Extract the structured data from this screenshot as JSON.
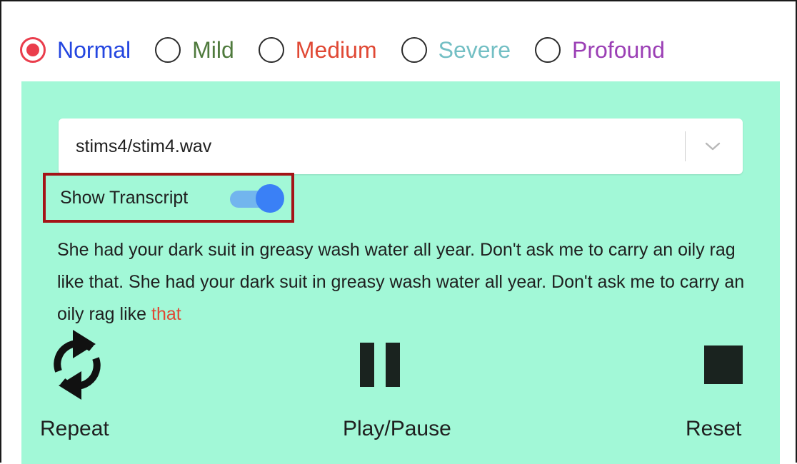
{
  "severity": {
    "options": [
      {
        "label": "Normal",
        "color": "#2446e0",
        "checked": true
      },
      {
        "label": "Mild",
        "color": "#4f7a3d",
        "checked": false
      },
      {
        "label": "Medium",
        "color": "#e04834",
        "checked": false
      },
      {
        "label": "Severe",
        "color": "#73bfc4",
        "checked": false
      },
      {
        "label": "Profound",
        "color": "#9b3fb5",
        "checked": false
      }
    ],
    "selected_color": "#ea3d4c"
  },
  "panel": {
    "background": "#a2f8d7"
  },
  "file_select": {
    "value": "stims4/stim4.wav",
    "icon": "chevron-down-icon"
  },
  "transcript_toggle": {
    "label": "Show Transcript",
    "on": true
  },
  "transcript": {
    "text": "She had your dark suit in greasy wash water all year. Don't ask me to carry an oily rag like that. She had your dark suit in greasy wash water all year. Don't ask me to carry an oily rag like ",
    "highlighted_word": "that",
    "highlight_color": "#e04834"
  },
  "controls": {
    "repeat": {
      "label": "Repeat",
      "icon": "repeat-icon"
    },
    "play_pause": {
      "label": "Play/Pause",
      "icon": "pause-icon"
    },
    "reset": {
      "label": "Reset",
      "icon": "stop-icon"
    }
  }
}
